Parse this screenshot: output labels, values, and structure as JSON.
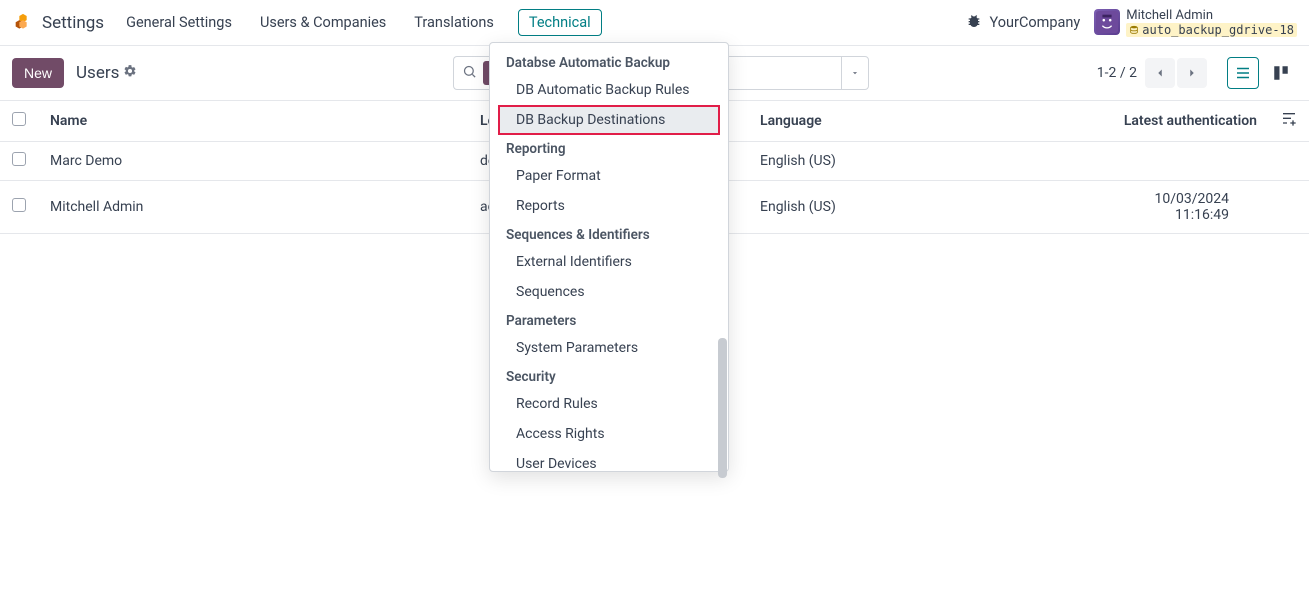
{
  "topnav": {
    "app_title": "Settings",
    "items": [
      "General Settings",
      "Users & Companies",
      "Translations",
      "Technical"
    ],
    "active_index": 3,
    "company": "YourCompany",
    "user_name": "Mitchell Admin",
    "db_name": "auto_backup_gdrive-18"
  },
  "control": {
    "new_label": "New",
    "breadcrumb": "Users",
    "pager_text": "1-2 / 2"
  },
  "dropdown": {
    "sections": [
      {
        "header": "Databse Automatic Backup",
        "items": [
          "DB Automatic Backup Rules",
          "DB Backup Destinations"
        ]
      },
      {
        "header": "Reporting",
        "items": [
          "Paper Format",
          "Reports"
        ]
      },
      {
        "header": "Sequences & Identifiers",
        "items": [
          "External Identifiers",
          "Sequences"
        ]
      },
      {
        "header": "Parameters",
        "items": [
          "System Parameters"
        ]
      },
      {
        "header": "Security",
        "items": [
          "Record Rules",
          "Access Rights",
          "User Devices"
        ]
      }
    ],
    "highlighted": "DB Backup Destinations"
  },
  "table": {
    "columns": {
      "name": "Name",
      "login": "Login",
      "language": "Language",
      "latest_auth": "Latest authentication"
    },
    "rows": [
      {
        "name": "Marc Demo",
        "login": "demo",
        "language": "English (US)",
        "latest_auth": ""
      },
      {
        "name": "Mitchell Admin",
        "login": "admin",
        "language": "English (US)",
        "latest_auth": "10/03/2024 11:16:49"
      }
    ]
  }
}
